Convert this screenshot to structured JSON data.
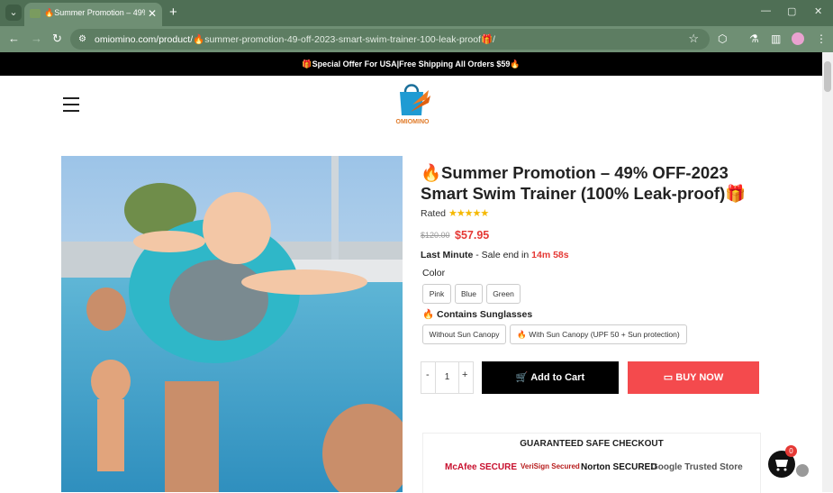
{
  "browser": {
    "tab_title": "🔥Summer Promotion – 49% ...",
    "tab_close": "✕",
    "new_tab": "+",
    "win_min": "—",
    "win_max": "▢",
    "win_close": "✕",
    "url_host": "omiomino.com/product/",
    "url_path": "🔥summer-promotion-49-off-2023-smart-swim-trainer-100-leak-proof🎁/"
  },
  "banner": {
    "text": "🎁Special Offer For USA|Free Shipping All Orders $59🔥"
  },
  "logo": {
    "text": "OMIOMINO"
  },
  "product": {
    "title": "🔥Summer Promotion – 49% OFF-2023 Smart Swim Trainer (100% Leak-proof)🎁",
    "rated_label": "Rated",
    "stars": "★★★★★",
    "old_price": "$120.00",
    "price": "$57.95",
    "last_minute": "Last Minute",
    "sale_text": " - Sale end in ",
    "timer": "14m 58s",
    "color_label": "Color",
    "colors": [
      "Pink",
      "Blue",
      "Green"
    ],
    "sunglasses_label": "🔥 Contains Sunglasses",
    "canopy_options": [
      "Without Sun Canopy",
      "🔥 With Sun Canopy (UPF 50 + Sun protection)"
    ],
    "qty_minus": "-",
    "qty_value": "1",
    "qty_plus": "+",
    "add_to_cart": "Add to Cart",
    "buy_now": "BUY NOW"
  },
  "checkout": {
    "title": "GUARANTEED SAFE CHECKOUT",
    "badges": [
      "McAfee SECURE",
      "VeriSign Secured",
      "Norton SECURED",
      "Google Trusted Store"
    ]
  },
  "cart": {
    "count": "0"
  },
  "colors": {
    "accent_red": "#e53935",
    "buy_now": "#f44a4d",
    "chrome_green": "#4f6f55"
  }
}
